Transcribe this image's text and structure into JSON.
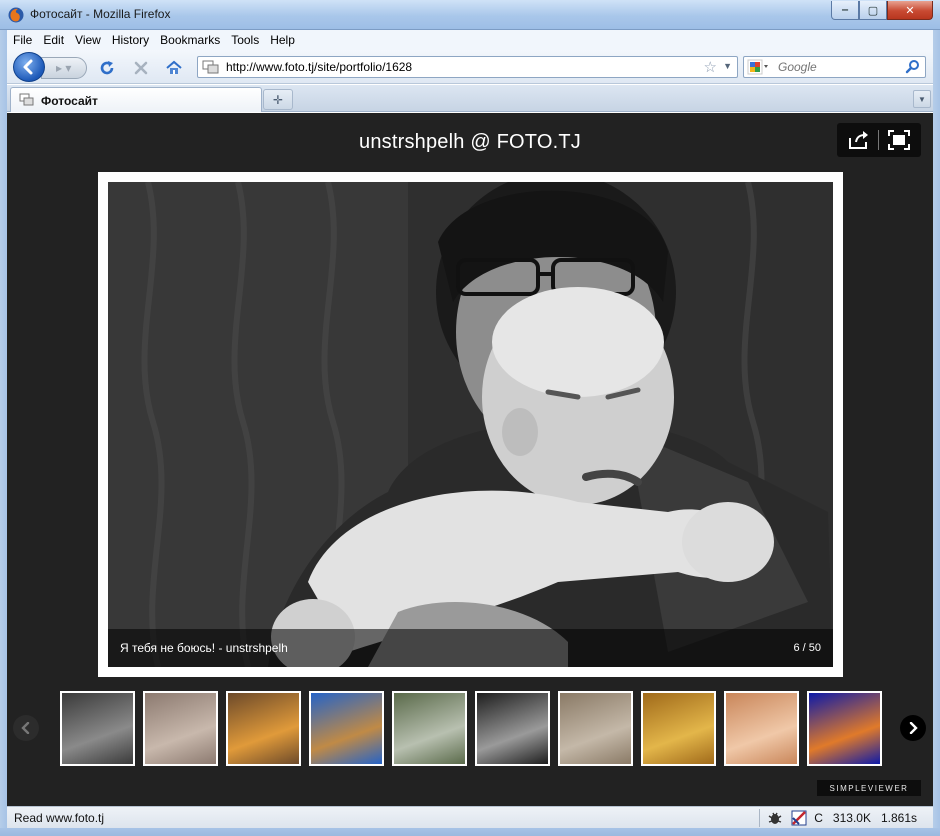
{
  "window": {
    "title": "Фотосайт - Mozilla Firefox",
    "controls": {
      "minimize": "‒",
      "maximize": "▢",
      "close": "✕"
    }
  },
  "menu": {
    "items": [
      "File",
      "Edit",
      "View",
      "History",
      "Bookmarks",
      "Tools",
      "Help"
    ]
  },
  "navigation": {
    "url": "http://www.foto.tj/site/portfolio/1628",
    "search_placeholder": "Google"
  },
  "tabs": [
    {
      "label": "Фотосайт",
      "active": true
    }
  ],
  "viewer": {
    "title": "unstrshpelh @ FOTO.TJ",
    "caption": "Я тебя не боюсь! - unstrshpelh",
    "counter": "6 / 50",
    "branding": "SIMPLEVIEWER",
    "thumbnails": [
      {
        "subject": "people-with-horse",
        "colors": [
          "#3a3a3a",
          "#8a8a8a"
        ]
      },
      {
        "subject": "child-on-street",
        "colors": [
          "#8c7a70",
          "#c8b8ac"
        ]
      },
      {
        "subject": "children-in-orange",
        "colors": [
          "#6d4a2a",
          "#e09a3a"
        ]
      },
      {
        "subject": "blue-sky-landscape",
        "colors": [
          "#2563c7",
          "#c08a46"
        ]
      },
      {
        "subject": "children-running",
        "colors": [
          "#5a6a4a",
          "#b8c0b0"
        ]
      },
      {
        "subject": "father-and-baby",
        "colors": [
          "#1e1e1e",
          "#9a9a9a"
        ]
      },
      {
        "subject": "toddler-in-overalls",
        "colors": [
          "#8a7a66",
          "#c4b8a8"
        ]
      },
      {
        "subject": "autumn-trees-road",
        "colors": [
          "#a06a1a",
          "#e3b64a"
        ]
      },
      {
        "subject": "baby-portrait",
        "colors": [
          "#c9865a",
          "#f0c8a8"
        ]
      },
      {
        "subject": "jellyfish",
        "colors": [
          "#0d1aa8",
          "#e07a2a"
        ]
      }
    ]
  },
  "status": {
    "text": "Read www.foto.tj",
    "indicator_c": "C",
    "size": "313.0K",
    "time": "1.861s"
  }
}
